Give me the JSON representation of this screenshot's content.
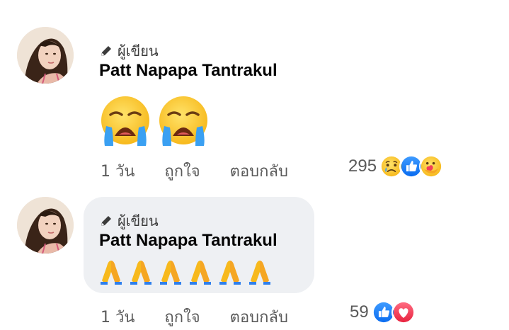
{
  "comments": [
    {
      "author_badge": "ผู้เขียน",
      "author_name": "Patt Napapa Tantrakul",
      "content_emoji": [
        "loudly-crying-face",
        "loudly-crying-face"
      ],
      "time": "1 วัน",
      "like_label": "ถูกใจ",
      "reply_label": "ตอบกลับ",
      "reaction_count": "295",
      "reactions": [
        "sad-reaction-icon",
        "like-reaction-icon",
        "care-reaction-icon"
      ]
    },
    {
      "author_badge": "ผู้เขียน",
      "author_name": "Patt Napapa Tantrakul",
      "content_emoji": [
        "folded-hands",
        "folded-hands",
        "folded-hands",
        "folded-hands",
        "folded-hands",
        "folded-hands"
      ],
      "time": "1 วัน",
      "like_label": "ถูกใจ",
      "reply_label": "ตอบกลับ",
      "reaction_count": "59",
      "reactions": [
        "like-reaction-icon",
        "love-reaction-icon"
      ]
    }
  ],
  "colors": {
    "bubble": "#eef0f3",
    "like_blue": "#1877f2",
    "love_red": "#f33e58",
    "emoji_yellow": "#ffcc33",
    "secondary_text": "#5a5a5a"
  }
}
